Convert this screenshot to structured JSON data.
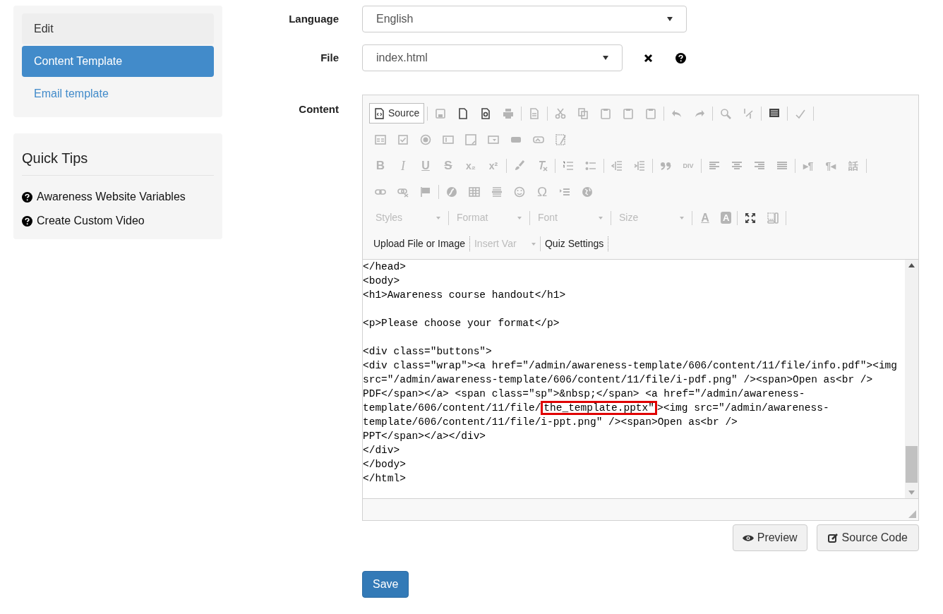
{
  "sidebar": {
    "items": [
      {
        "label": "Edit",
        "selected": false,
        "kind": "item"
      },
      {
        "label": "Content Template",
        "selected": true,
        "kind": "item"
      },
      {
        "label": "Email template",
        "selected": false,
        "kind": "link"
      }
    ]
  },
  "quick_tips": {
    "title": "Quick Tips",
    "links": [
      "Awareness Website Variables",
      "Create Custom Video"
    ]
  },
  "form": {
    "language": {
      "label": "Language",
      "value": "English"
    },
    "file": {
      "label": "File",
      "value": "index.html"
    },
    "content_label": "Content"
  },
  "editor": {
    "source_button": "Source",
    "glyphs": [
      "B",
      "I",
      "U",
      "S",
      "x₂",
      "x²",
      "DIV",
      "▸¶",
      "¶◂",
      "話",
      "Ω",
      "A",
      "A"
    ],
    "dropdowns": [
      {
        "label": "Styles",
        "disabled": true
      },
      {
        "label": "Format",
        "disabled": true
      },
      {
        "label": "Font",
        "disabled": true
      },
      {
        "label": "Size",
        "disabled": true
      }
    ],
    "plugins": [
      {
        "label": "Upload File or Image",
        "kind": "button",
        "disabled": false
      },
      {
        "label": "Insert Var",
        "kind": "dropdown",
        "disabled": true
      },
      {
        "label": "Quiz Settings",
        "kind": "button",
        "disabled": false
      }
    ],
    "code_lines": [
      {
        "text": "</head>"
      },
      {
        "text": "<body>"
      },
      {
        "text": "<h1>Awareness course handout</h1>"
      },
      {
        "text": "<p>Please choose your format</p>",
        "gap_before": true
      },
      {
        "text": "<div class=\"buttons\">",
        "gap_before": true
      },
      {
        "text": "<div class=\"wrap\"><a href=\"/admin/awareness-template/606/content/11/file/info.pdf\"><img"
      },
      {
        "text": "src=\"/admin/awareness-template/606/content/11/file/i-pdf.png\" /><span>Open as<br />"
      },
      {
        "text": "PDF</span></a> <span class=\"sp\">&nbsp;</span> <a href=\"/admin/awareness-"
      },
      {
        "text": "template/606/content/11/file/",
        "highlight": "the_template.pptx\"",
        "after": "><img src=\"/admin/awareness-"
      },
      {
        "text": "template/606/content/11/file/i-ppt.png\" /><span>Open as<br />"
      },
      {
        "text": "PPT</span></a></div>"
      },
      {
        "text": "</div>"
      },
      {
        "text": "</body>"
      },
      {
        "text": "</html>"
      }
    ]
  },
  "buttons": {
    "preview": "Preview",
    "source_code": "Source Code",
    "save": "Save"
  }
}
